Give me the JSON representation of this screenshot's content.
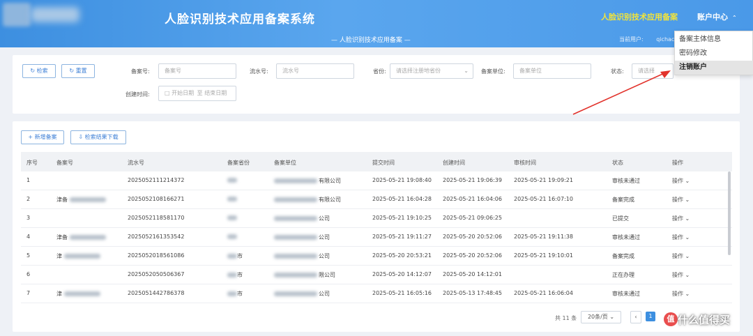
{
  "header": {
    "system_title": "人脸识别技术应用备案系统",
    "top_link": "人脸识别技术应用备案",
    "account_center": "账户中心",
    "subtitle": "— 人脸识别技术应用备案 —",
    "current_user_label": "当前用户:",
    "current_user_value": "qichac"
  },
  "account_dropdown": {
    "items": [
      "备案主体信息",
      "密码修改",
      "注销账户"
    ],
    "active_index": 2
  },
  "filters": {
    "search_button": "检索",
    "reset_button": "重置",
    "record_no_label": "备案号:",
    "record_no_placeholder": "备案号",
    "serial_no_label": "流水号:",
    "serial_no_placeholder": "流水号",
    "region_label": "省份:",
    "region_placeholder": "请选择注册地省份",
    "unit_label": "备案单位:",
    "unit_placeholder": "备案单位",
    "status_label": "状态:",
    "status_placeholder": "请选择",
    "created_label": "创建时间:",
    "start_date_placeholder": "开始日期",
    "end_date_placeholder": "结束日期",
    "date_separator": "至"
  },
  "toolbar": {
    "add_button": "新增备案",
    "download_button": "检索结果下载"
  },
  "table": {
    "columns": [
      "序号",
      "备案号",
      "流水号",
      "备案省份",
      "备案单位",
      "提交时间",
      "创建时间",
      "审核时间",
      "状态",
      "操作"
    ],
    "rows": [
      {
        "no": "1",
        "record": "",
        "serial": "2025052111214372",
        "province": "",
        "unit_suffix": "有限公司",
        "submitted": "2025-05-21 19:08:40",
        "created": "2025-05-21 19:06:39",
        "reviewed": "2025-05-21 19:09:21",
        "status": "审核未通过",
        "op": "操作"
      },
      {
        "no": "2",
        "record": "津备",
        "serial": "2025052108166271",
        "province": "",
        "unit_suffix": "有限公司",
        "submitted": "2025-05-21 16:04:28",
        "created": "2025-05-21 16:04:06",
        "reviewed": "2025-05-21 16:07:10",
        "status": "备案完成",
        "op": "操作"
      },
      {
        "no": "3",
        "record": "",
        "serial": "2025052118581170",
        "province": "",
        "unit_suffix": "公司",
        "submitted": "2025-05-21 19:10:25",
        "created": "2025-05-21 09:06:25",
        "reviewed": "",
        "status": "已提交",
        "op": "操作"
      },
      {
        "no": "4",
        "record": "津备",
        "serial": "2025052161353542",
        "province": "",
        "unit_suffix": "公司",
        "submitted": "2025-05-21 19:11:27",
        "created": "2025-05-20 20:52:06",
        "reviewed": "2025-05-21 19:11:38",
        "status": "审核未通过",
        "op": "操作"
      },
      {
        "no": "5",
        "record": "津",
        "serial": "2025052018561086",
        "province": "市",
        "unit_suffix": "公司",
        "submitted": "2025-05-20 20:53:21",
        "created": "2025-05-20 20:52:06",
        "reviewed": "2025-05-21 19:10:01",
        "status": "备案完成",
        "op": "操作"
      },
      {
        "no": "6",
        "record": "",
        "serial": "2025052050506367",
        "province": "市",
        "unit_suffix": "限公司",
        "submitted": "2025-05-20 14:12:07",
        "created": "2025-05-20 14:12:01",
        "reviewed": "",
        "status": "正在办理",
        "op": "操作"
      },
      {
        "no": "7",
        "record": "津",
        "serial": "2025051442786378",
        "province": "市",
        "unit_suffix": "公司",
        "submitted": "2025-05-21 16:05:16",
        "created": "2025-05-13 17:48:45",
        "reviewed": "2025-05-21 16:06:04",
        "status": "审核未通过",
        "op": "操作"
      }
    ]
  },
  "pagination": {
    "total": "共 11 条",
    "page_size": "20条/页",
    "prev": "‹",
    "current_page": "1",
    "goto_label": "前往"
  },
  "watermark": {
    "icon": "值",
    "text": "什么值得买"
  }
}
